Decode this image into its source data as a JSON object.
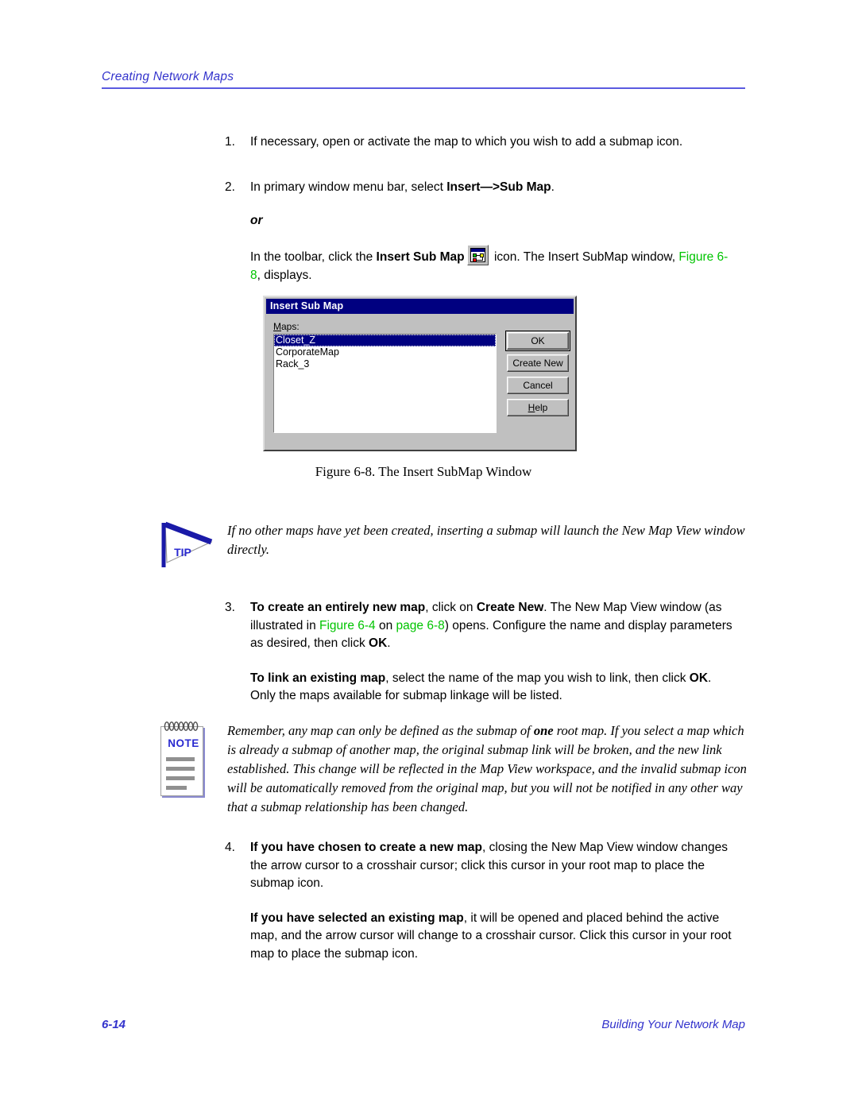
{
  "header": {
    "running_head": "Creating Network Maps"
  },
  "steps": {
    "step1": {
      "number": "1.",
      "text": "If necessary, open or activate the map to which you wish to add a submap icon."
    },
    "step2": {
      "number": "2.",
      "line1_prefix": "In primary window menu bar, select ",
      "line1_bold": "Insert—>Sub Map",
      "line1_suffix": ".",
      "or_word": "or",
      "line2_prefix": "In the toolbar, click the ",
      "line2_bold": "Insert Sub Map",
      "icon_name": "insert-sub-map-icon",
      "line2_mid": " icon. The Insert SubMap window, ",
      "line2_xref": "Figure 6-8",
      "line2_suffix": ", displays."
    },
    "step3": {
      "number": "3.",
      "p1_bold": "To create an entirely new map",
      "p1_a": ", click on ",
      "p1_bold2": "Create New",
      "p1_b": ". The New Map View window (as illustrated in ",
      "p1_xref1": "Figure 6-4",
      "p1_c": " on ",
      "p1_xref2": "page 6-8",
      "p1_d": ") opens. Configure the name and display parameters as desired, then click ",
      "p1_bold3": "OK",
      "p1_e": ".",
      "p2_bold": "To link an existing map",
      "p2_a": ", select the name of the map you wish to link, then click ",
      "p2_bold2": "OK",
      "p2_b": ". Only the maps available for submap linkage will be listed."
    },
    "step4": {
      "number": "4.",
      "p1_bold": "If you have chosen to create a new map",
      "p1_a": ", closing the New Map View window changes the arrow cursor to a crosshair cursor; click this cursor in your root map to place the submap icon.",
      "p2_bold": "If you have selected an existing map",
      "p2_a": ", it will be opened and placed behind the active map, and the arrow cursor will change to a crosshair cursor. Click this cursor in your root map to place the submap icon."
    }
  },
  "dialog": {
    "title": "Insert Sub Map",
    "maps_label_accel": "M",
    "maps_label_rest": "aps:",
    "list_items": [
      {
        "label": "Closet_Z",
        "selected": true
      },
      {
        "label": "CorporateMap",
        "selected": false
      },
      {
        "label": "Rack_3",
        "selected": false
      }
    ],
    "buttons": [
      {
        "label": "OK",
        "default": true,
        "accel": ""
      },
      {
        "label": "Create New",
        "default": false,
        "accel": ""
      },
      {
        "label": "Cancel",
        "default": false,
        "accel": ""
      },
      {
        "label": "Help",
        "default": false,
        "accel": "H"
      }
    ]
  },
  "figure_caption": "Figure 6-8.  The Insert SubMap Window",
  "tip_callout": {
    "label": "TIP",
    "text": "If no other maps have yet been created, inserting a submap will launch the New Map View window directly."
  },
  "note_callout": {
    "label": "NOTE",
    "text_a": "Remember, any map can only be defined as the submap of ",
    "text_bold": "one",
    "text_b": " root map. If you select a map which is already a submap of another map, the original submap link will be broken, and the new link established. This change will be reflected in the Map View workspace, and the invalid submap icon will be automatically removed from the original map, but you will not be notified in any other way that a submap relationship has been changed."
  },
  "footer": {
    "page_number": "6-14",
    "book_section": "Building Your Network Map"
  },
  "colors": {
    "header_blue": "#3333cc",
    "rule_blue": "#5a5ae0",
    "xref_green": "#00c400",
    "title_bar_navy": "#000080",
    "dialog_face": "#c0c0c0"
  }
}
